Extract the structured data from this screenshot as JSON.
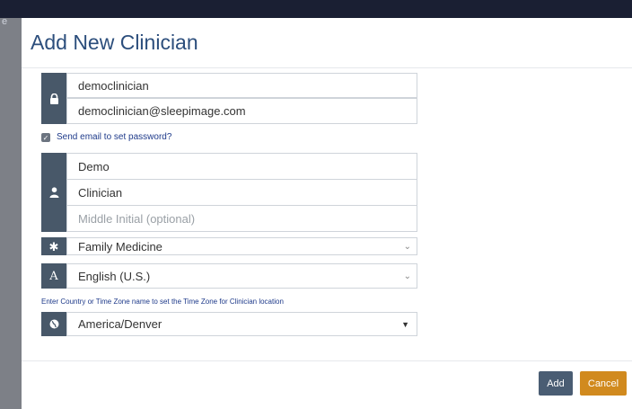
{
  "backdrop": {
    "edge_text": "e"
  },
  "modal": {
    "title": "Add New Clinician"
  },
  "account": {
    "username": "democlinician",
    "email": "democlinician@sleepimage.com",
    "send_email_label": "Send email to set password?",
    "send_email_checked": true
  },
  "name": {
    "first": "Demo",
    "last": "Clinician",
    "middle_placeholder": "Middle Initial (optional)"
  },
  "specialty": {
    "value": "Family Medicine"
  },
  "language": {
    "icon_letter": "A",
    "value": "English (U.S.)"
  },
  "timezone": {
    "hint": "Enter Country or Time Zone name to set the Time Zone for Clinician location",
    "value": "America/Denver"
  },
  "footer": {
    "add_label": "Add",
    "cancel_label": "Cancel"
  },
  "colors": {
    "addon": "#485869",
    "title": "#2c4e7c",
    "add_button": "#4a5d73",
    "cancel_button": "#d18a1e"
  }
}
